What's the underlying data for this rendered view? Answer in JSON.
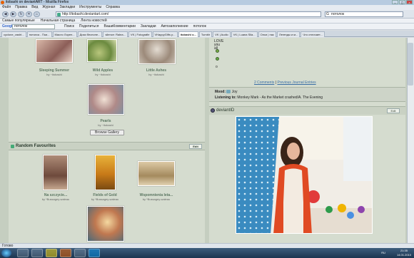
{
  "window": {
    "title": "itobashi on deviantART - Mozilla Firefox"
  },
  "menu": [
    "Файл",
    "Правка",
    "Вид",
    "Журнал",
    "Закладки",
    "Инструменты",
    "Справка"
  ],
  "nav": {
    "url": "http://itobashi.deviantart.com/",
    "search_value": "потолок"
  },
  "bookmarks": [
    "Самые популярные",
    "Начальная страница",
    "Лента новостей"
  ],
  "google_bar": {
    "label": "Google",
    "value": "потолок",
    "items": [
      "Поиск",
      "Поделиться",
      "ВашиКомментарии",
      "Закладки",
      "Автозаполнение",
      "потолок"
    ]
  },
  "tabs": [
    {
      "label": "cyclone_vasht..."
    },
    {
      "label": "потолок - Пои..."
    },
    {
      "label": "Масло Лорен..."
    },
    {
      "label": "Дизи беспоне..."
    },
    {
      "label": "silence: Ralea..."
    },
    {
      "label": "VK | Fotografie"
    },
    {
      "label": "VHappyGifts p..."
    },
    {
      "label": "itobashi o..."
    },
    {
      "label": "Tumblr"
    },
    {
      "label": "VK | Audio"
    },
    {
      "label": "VK | Luana Sila..."
    },
    {
      "label": "Олси | нас"
    },
    {
      "label": "Легенды и м..."
    },
    {
      "label": "Что отличает..."
    }
  ],
  "gallery": {
    "items": [
      {
        "title": "Sleeping Summer",
        "by": "by ~itobashi"
      },
      {
        "title": "Wild Apples",
        "by": "by ~itobashi"
      },
      {
        "title": "Little Ashes",
        "by": "by ~itobashi"
      },
      {
        "title": "Pearls",
        "by": "by ~itobashi"
      }
    ],
    "browse_label": "Browse Gallery"
  },
  "favourites": {
    "heading": "Random Favourites",
    "edit_label": "Edit",
    "items": [
      {
        "title": "Na szczycie...",
        "by": "by *Bussagey-waleau"
      },
      {
        "title": "Fields of Gold",
        "by": "by *Bussagey-waleau"
      },
      {
        "title": "Wspomnienia leta...",
        "by": "by *Bussagey-waleau"
      }
    ]
  },
  "journal": {
    "text_lines": [
      "LOVE",
      "you",
      "all",
      "o"
    ],
    "comments_link": "2 Comments",
    "separator": "|",
    "prev_link": "Previous Journal Entries",
    "mood_label": "Mood:",
    "mood_value": "Joy",
    "listening_label": "Listening to:",
    "listening_value": "Monkey Mark - As the Market crashed/A. The Evening"
  },
  "deviantid": {
    "heading": "deviantID",
    "edit_label": "Edit"
  },
  "status": {
    "text": "Готово"
  },
  "taskbar": {
    "time": "21:35",
    "date": "14.01.2010",
    "lang": "RU"
  }
}
